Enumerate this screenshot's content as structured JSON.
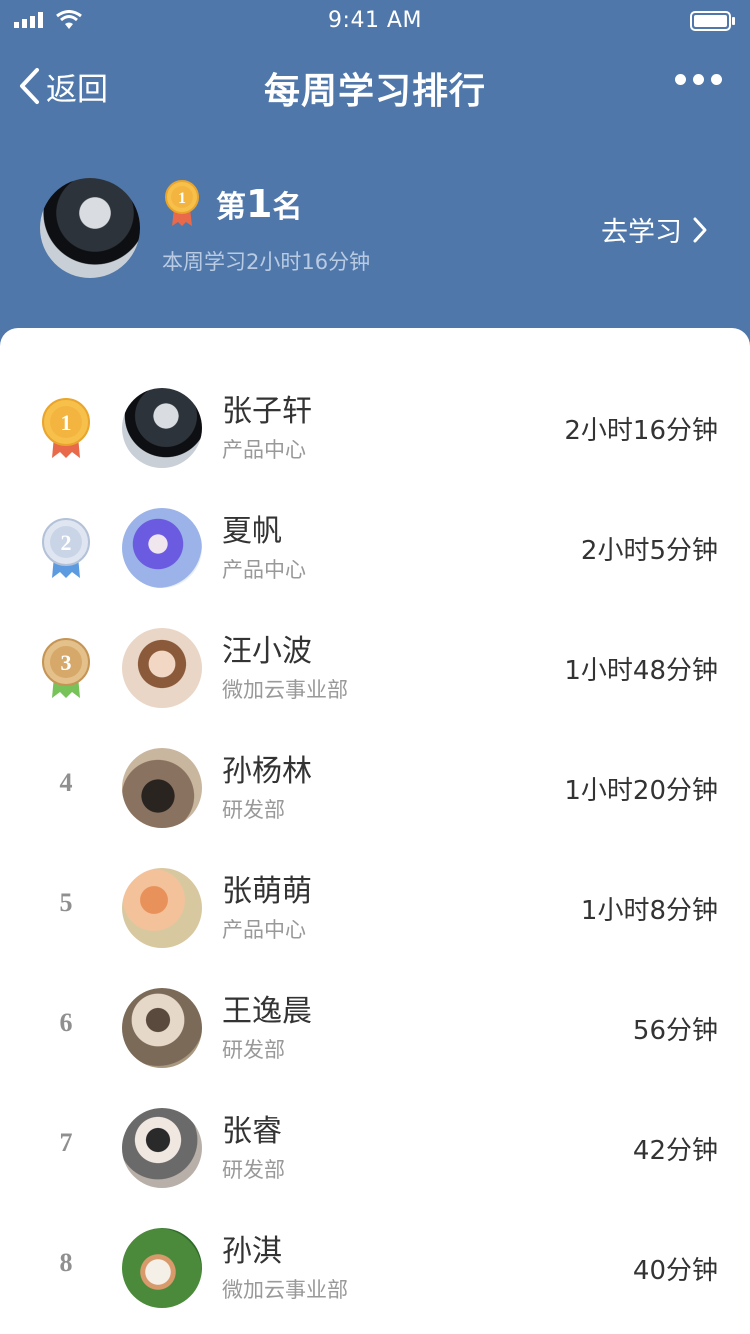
{
  "status_bar": {
    "time": "9:41 AM"
  },
  "nav": {
    "back_label": "返回",
    "title": "每周学习排行"
  },
  "my_rank": {
    "prefix": "第",
    "rank": "1",
    "suffix": "名",
    "summary": "本周学习2小时16分钟",
    "action_label": "去学习"
  },
  "colors": {
    "header_bg": "#4f77aa",
    "gold": "#f3b540",
    "silver": "#c9d5e6",
    "bronze": "#d6a96a"
  },
  "rankings": [
    {
      "rank": "1",
      "name": "张子轩",
      "dept": "产品中心",
      "time": "2小时16分钟",
      "medal": "gold"
    },
    {
      "rank": "2",
      "name": "夏帆",
      "dept": "产品中心",
      "time": "2小时5分钟",
      "medal": "silver"
    },
    {
      "rank": "3",
      "name": "汪小波",
      "dept": "微加云事业部",
      "time": "1小时48分钟",
      "medal": "bronze"
    },
    {
      "rank": "4",
      "name": "孙杨林",
      "dept": "研发部",
      "time": "1小时20分钟",
      "medal": ""
    },
    {
      "rank": "5",
      "name": "张萌萌",
      "dept": "产品中心",
      "time": "1小时8分钟",
      "medal": ""
    },
    {
      "rank": "6",
      "name": "王逸晨",
      "dept": "研发部",
      "time": "56分钟",
      "medal": ""
    },
    {
      "rank": "7",
      "name": "张睿",
      "dept": "研发部",
      "time": "42分钟",
      "medal": ""
    },
    {
      "rank": "8",
      "name": "孙淇",
      "dept": "微加云事业部",
      "time": "40分钟",
      "medal": ""
    }
  ]
}
